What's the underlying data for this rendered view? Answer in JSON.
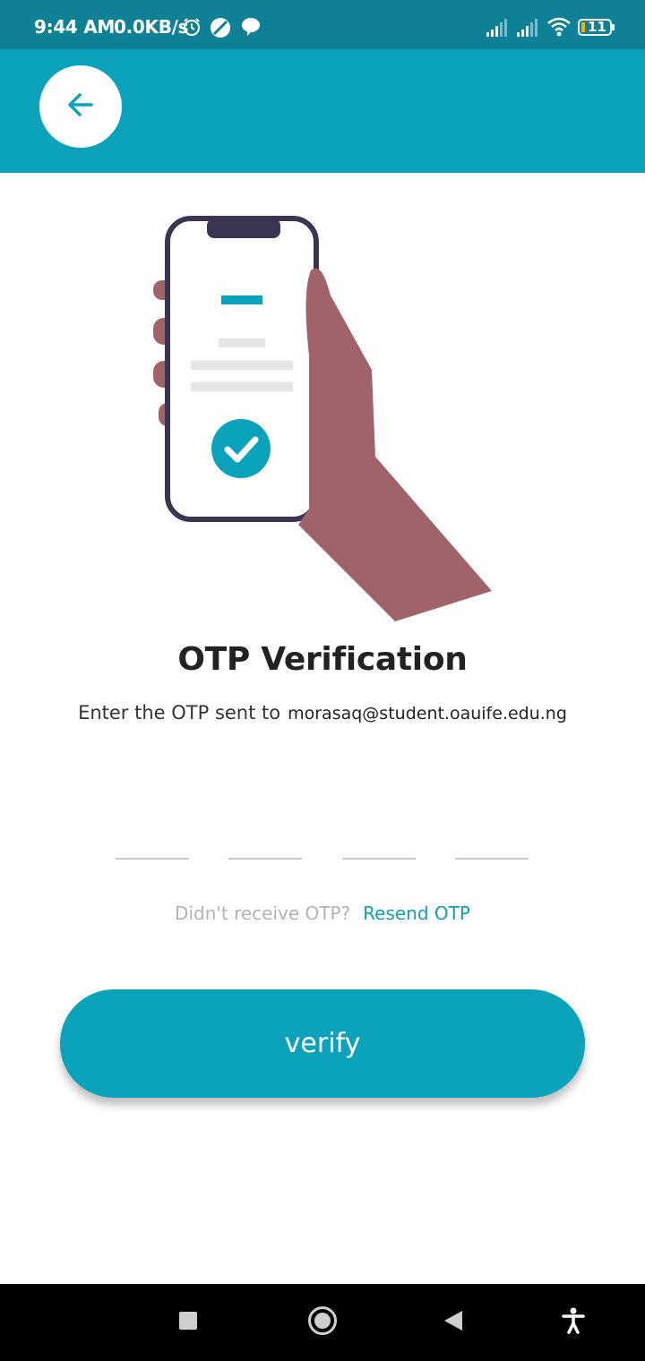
{
  "status_bar": {
    "time": "9:44 AM",
    "net_speed": "0.0KB/s",
    "battery_level": "11",
    "icons": [
      "alarm-icon",
      "compass-icon",
      "chat-bubble-icon",
      "signal-icon",
      "signal-icon",
      "wifi-icon",
      "battery-icon"
    ]
  },
  "header": {
    "back_icon": "arrow-left-icon"
  },
  "illustration": {
    "icon": "phone-in-hand-checkmark-illustration"
  },
  "main": {
    "title": "OTP Verification",
    "subtitle_prefix": "Enter the OTP sent to",
    "email": "morasaq@student.oauife.edu.ng",
    "otp_fields": [
      "",
      "",
      "",
      ""
    ],
    "resend_prompt": "Didn't receive OTP?",
    "resend_link": "Resend OTP",
    "verify_label": "verify"
  },
  "nav_bar": {
    "buttons": [
      "recents-square-icon",
      "home-circle-icon",
      "back-triangle-icon",
      "accessibility-icon"
    ]
  },
  "colors": {
    "status_bar": "#0f8197",
    "accent": "#0ba3bc",
    "link": "#0f9fb7",
    "hand": "#a0636a",
    "phone_frame": "#3b3553"
  }
}
